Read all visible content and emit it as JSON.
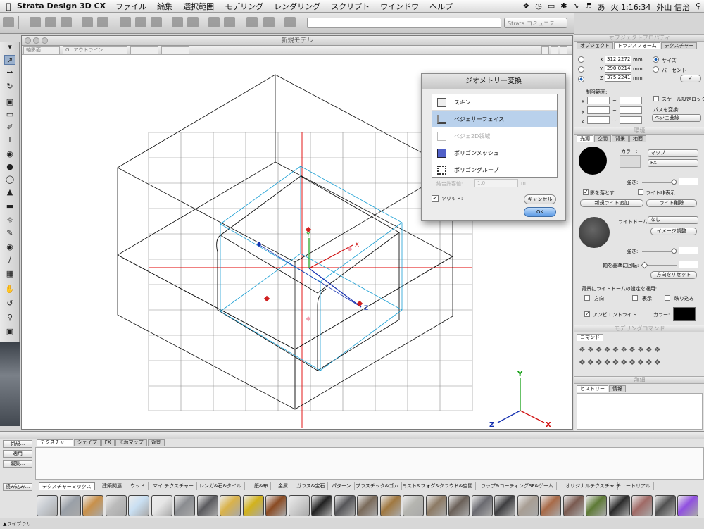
{
  "menubar": {
    "app": "Strata Design 3D CX",
    "items": [
      "ファイル",
      "編集",
      "選択範囲",
      "モデリング",
      "レンダリング",
      "スクリプト",
      "ウインドウ",
      "ヘルプ"
    ],
    "clock": "火 1:16:34",
    "user": "外山 信治",
    "ime": "あ"
  },
  "toolbar": {
    "strata_select": "Strata コミュニテ..."
  },
  "document": {
    "title": "新規モデル",
    "view_select": "軸影面",
    "render_select": "GL アウトライン"
  },
  "axes": {
    "y": "Y",
    "x": "X",
    "z": "Z"
  },
  "geometry_dialog": {
    "title": "ジオメトリー変換",
    "items": [
      {
        "label": "スキン",
        "state": "normal"
      },
      {
        "label": "ベジェサーフェイス",
        "state": "selected"
      },
      {
        "label": "ベジェ2D領域",
        "state": "disabled"
      },
      {
        "label": "ポリゴンメッシュ",
        "state": "normal"
      },
      {
        "label": "ポリゴングループ",
        "state": "normal"
      }
    ],
    "tolerance_label": "結合許容値:",
    "tolerance_value": "1.0",
    "tolerance_unit": "m",
    "solid_label": "ソリッド:",
    "cancel": "キャンセル",
    "ok": "OK"
  },
  "object_properties": {
    "title": "オブジェクトプロパティ",
    "tabs": [
      "オブジェクト",
      "トランスフォーム",
      "テクスチャー"
    ],
    "x_value": "312.2272",
    "y_value": "290.0214",
    "z_value": "375.2241",
    "unit": "mm",
    "mode_size": "サイズ",
    "mode_percent": "パーセント",
    "constraint_label": "制限範囲:",
    "constraint_axes": [
      "x",
      "y",
      "z"
    ],
    "scale_lock": "スケール設定ロック",
    "path_convert_label": "パスを変換:",
    "path_convert_value": "ベジェ曲線"
  },
  "environment": {
    "title": "環境",
    "tabs": [
      "光源",
      "空間",
      "背景",
      "地面"
    ],
    "color_label": "カラー:",
    "map_select": "マップ",
    "fx_select": "FX",
    "intensity_label": "強さ:",
    "cast_shadow": "影を落とす",
    "light_hidden": "ライト非表示",
    "add_light": "新規ライト追加",
    "delete_light": "ライト削除",
    "lightdome_label": "ライトドーム:",
    "lightdome_value": "なし",
    "image_adjust": "イメージ調整...",
    "intensity2_label": "強さ:",
    "rotate_label": "軸を基準に回転:",
    "reset_direction": "方向をリセット",
    "apply_label": "背景にライトドームの設定を適用:",
    "apply_direction": "方向",
    "apply_display": "表示",
    "apply_reflect": "映り込み",
    "ambient_label": "アンビエントライト",
    "ambient_color_label": "カラー:"
  },
  "modeling_commands": {
    "title": "モデリングコマンド",
    "tab": "コマンド"
  },
  "details": {
    "title": "詳細",
    "tabs": [
      "ヒストリー",
      "情報"
    ]
  },
  "library": {
    "buttons": [
      "新規...",
      "適用",
      "編集...",
      "読み込み..."
    ],
    "top_tabs": [
      "テクスチャー",
      "シェイプ",
      "FX",
      "光源マップ",
      "背景"
    ],
    "categories": [
      "テクスチャーミックス",
      "建築関連",
      "ウッド",
      "マイ テクスチャー",
      "レンガ&石&タイル",
      "紙&布",
      "金属",
      "ガラス&宝石",
      "パターン",
      "プラスチック&ゴム",
      "ミスト&フォグ&クラウド&空間",
      "ラップ&コーティング",
      "SF&ゲーム",
      "オリジナルテクスチャ",
      "チュートリアル"
    ],
    "footer": "▲ライブラリ",
    "swatch_colors": [
      "#c8ccd2",
      "#9aa0a8",
      "#c8904a",
      "#bbbbbb",
      "#c9dff2",
      "#e6e6e6",
      "#8a8c90",
      "#5a5a5e",
      "#d9b24a",
      "#d2b21c",
      "#8a4a22",
      "#cfcfcf",
      "#202020",
      "#555558",
      "#7a6a5a",
      "#a07840",
      "#b5b5b0",
      "#8c7a64",
      "#6a6058",
      "#6a6a70",
      "#3e3e40",
      "#a89e94",
      "#a86a48",
      "#7a5a50",
      "#5e7a36",
      "#2a2a2a",
      "#a06a66",
      "#505050",
      "#9050e0"
    ]
  }
}
